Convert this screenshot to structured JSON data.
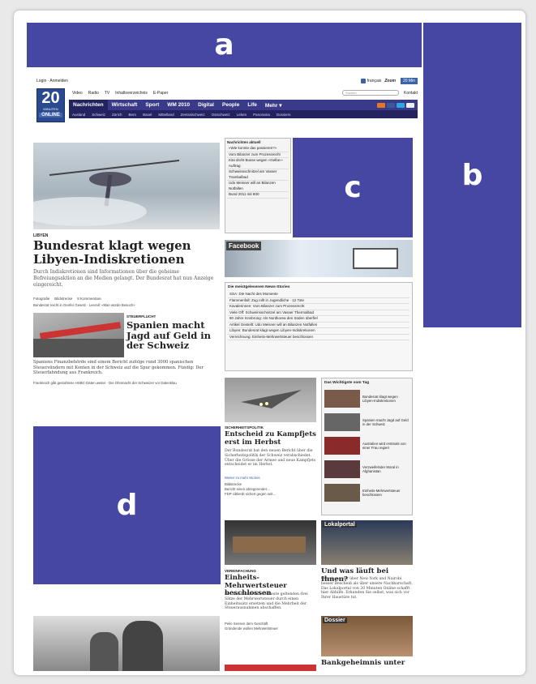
{
  "labels": {
    "a": "a",
    "b": "b",
    "c": "c",
    "d": "d"
  },
  "topbar": {
    "login": "Login · Anmelden",
    "lang": "français",
    "brand": "Zoom",
    "search_placeholder": "Suchen",
    "contact": "Kontakt"
  },
  "logo": {
    "number": "20",
    "sub": "MINUTEN",
    "online": "ONLINE"
  },
  "services": [
    "Video",
    "Radio",
    "TV",
    "Inhaltsverzeichnis",
    "E-Paper"
  ],
  "nav": [
    "Nachrichten",
    "Wirtschaft",
    "Sport",
    "WM 2010",
    "Digital",
    "People",
    "Life",
    "Mehr ▾"
  ],
  "subnav": [
    "Ausland",
    "Schweiz",
    "Zürich",
    "Bern",
    "Basel",
    "Mittelland",
    "Zentralschweiz",
    "Ostschweiz",
    "Leben",
    "Panorama",
    "Dossiers"
  ],
  "lead": {
    "kicker": "LIBYEN",
    "title": "Bundesrat klagt wegen Libyen-Indiskretionen",
    "lede": "Durch Indiskretionen sind Informationen über die geheime Befreiungsaktion an die Medien gelangt. Der Bundesrat hat nun Anzeige eingereicht.",
    "meta": [
      "Fotografie",
      "Bildstrecke",
      "8 Kommentare"
    ],
    "links": "Bundesrat reicht in Genfer Gesetz · Leerall: «Man würde Besuch»"
  },
  "second": {
    "kicker": "STEUERFLUCHT",
    "title": "Spanien macht Jagd auf Geld in der Schweiz",
    "lede": "Spaniens Finanzbehörde sind einem Bericht zufolge rund 3000 spanischen Steuersündern mit Konten in der Schweiz auf die Spur gekommen. Fündig: Der Steuerfahndung aus Frankreich.",
    "links": "Frankreich gibt gestohlene HSBC-Daten weiter · Die Ohnmacht der Schweizer vor Datenklau"
  },
  "ticker": {
    "title": "Nachrichten aktuell",
    "items": [
      "«Wie konnte das passieren?»",
      "Vom Bilanzer zum Prozessrecht",
      "Kita droht Busse wegen «Gelbe»-Auftrag",
      "Schweinsschnitzel am Vasser Trambalbad",
      "Udo Meisner will an Bilanzen Notfallen",
      "Bund 2011 mit 800"
    ]
  },
  "facebook": {
    "label": "Facebook"
  },
  "mostread": {
    "title": "Die meistgelesenen News-Stories",
    "items": [
      "SSA: Die Nacht des Momente",
      "Flammenfall: Zug rollt in Jugendliche · 12 Tote",
      "Kavalerinnen: Vom Bilanzer zum Prozessrecht",
      "Viele Off: Schweinsschnitzel am Vasser Thermalbad",
      "80 Jahre Innsbrung: Als Nordkorea den Süden überfiel",
      "Artikel Gestellt: Udo Meisner will an Bilanzen Notfallen",
      "Libyen: Bundesrat klagt wegen Libyen-Indiskretionen",
      "Verrechnung: Einheits-Mehrwertsteuer beschlossen"
    ]
  },
  "jet": {
    "kicker": "SICHERHEITSPOLITIK",
    "title": "Entscheid zu Kampfjets erst im Herbst",
    "lede": "Der Bundesrat hat den neuen Bericht über die Sicherheitspolitik der Schweiz verabschiedet. Über die Grösse der Armee und neue Kampfjets entscheidet er im Herbst.",
    "more": "Weiter zu mehr Stories",
    "links": [
      "Bildstrecke",
      "Bericht einen abregerendet…",
      "FDP ciblierdt sichert gegen seit…"
    ]
  },
  "important": {
    "title": "Das Wichtigste vom Tag",
    "items": [
      "Bundesrat klagt wegen Libyen-Indiskretionen",
      "Spanien macht Jagd auf Geld in der Schweiz",
      "Australien wird erstmals von einer Frau regiert",
      "Verzweifelnder Moral in Afghanistan",
      "Einheits-Mehrwertsteuer beschlossen"
    ]
  },
  "tax": {
    "kicker": "VEREINFACHUNG",
    "title": "Einheits-Mehrwertsteuer beschlossen",
    "lede": "Der Bundesrat will die heute geltenden drei Sätze der Mehrwertsteuer durch einen Einheitssatz ersetzen und die Mehrheit der Steuerausnahmen abschaffen.",
    "links": [
      "Peilo Sensen dem Geschäft",
      "Gründende wollen Mehrwertsteuer"
    ]
  },
  "local": {
    "label": "Lokalportal",
    "title": "Und was läuft bei Ihnen?",
    "lede": "Oft wissen wir über New York und Nairobi besser Bescheid als über unsere Nachbarschaft. Das Lokalportal von 20 Minuten Online schafft hier Abhilfe. Erkunden Sie selbst, was sich vor Ihrer Haustüre tut."
  },
  "dossier": {
    "label": "Dossier",
    "title": "Bankgeheimnis unter"
  }
}
